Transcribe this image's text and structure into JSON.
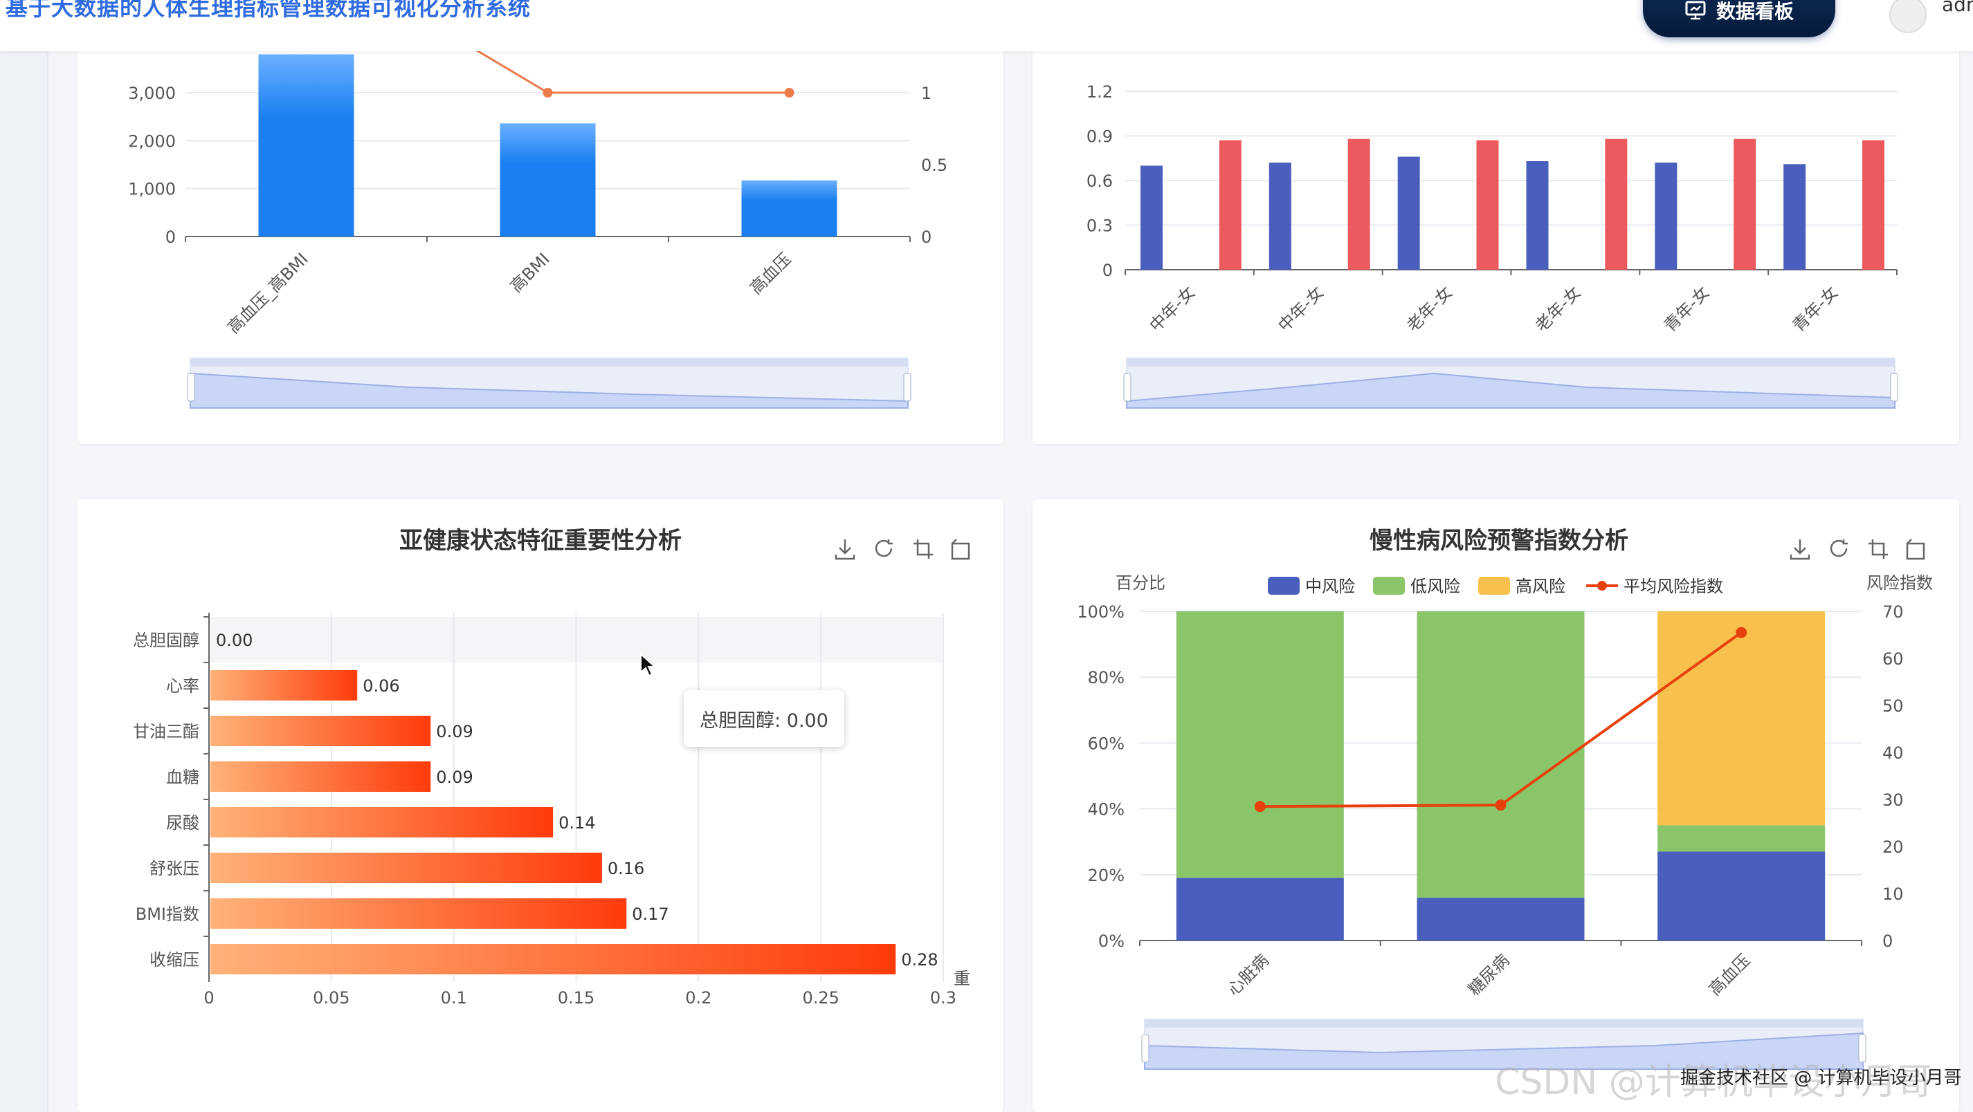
{
  "header": {
    "app_title": "基于大数据的人体生理指标管理数据可视化分析系统",
    "dashboard_button": "数据看板",
    "user": "adm"
  },
  "tooltip": {
    "text": "总胆固醇: 0.00"
  },
  "watermark": {
    "csdn": "CSDN @计算机毕设小月哥",
    "juejin": "掘金技术社区 @ 计算机毕设小月哥"
  },
  "colors": {
    "blue": "#1a7ff0",
    "navy": "#4a5fbd",
    "red": "#ec5a5e",
    "green": "#8ac56a",
    "yellow": "#f8c14e",
    "orange_line": "#e8400c"
  },
  "toolbox_icons": [
    "download-icon",
    "refresh-icon",
    "zoom-icon",
    "restore-icon"
  ],
  "chart_data": [
    {
      "type": "bar",
      "title": "",
      "categories": [
        "高血压_高BMI",
        "高BMI",
        "高血压"
      ],
      "series": [
        {
          "values": [
            3800,
            2360,
            1170
          ],
          "axis": "left"
        },
        {
          "values": [
            2.0,
            1,
            1
          ],
          "axis": "right",
          "kind": "line"
        }
      ],
      "y_ticks": [
        "0",
        "1,000",
        "2,000",
        "3,000"
      ],
      "y2_ticks": [
        "0",
        "0.5",
        "1"
      ],
      "ylim": [
        0,
        3000
      ],
      "y2lim": [
        0,
        1
      ],
      "grid": true
    },
    {
      "type": "bar",
      "title": "",
      "categories": [
        "中年-女",
        "中年-女",
        "老年-女",
        "老年-女",
        "青年-女",
        "青年-女"
      ],
      "series": [
        {
          "values": [
            0.7,
            0.72,
            0.76,
            0.73,
            0.72,
            0.71
          ]
        },
        {
          "values": [
            0.87,
            0.88,
            0.87,
            0.88,
            0.88,
            0.87
          ]
        }
      ],
      "y_ticks": [
        "0",
        "0.3",
        "0.6",
        "0.9",
        "1.2"
      ],
      "ylim": [
        0,
        1.2
      ],
      "grid": true
    },
    {
      "type": "bar",
      "orientation": "horizontal",
      "title": "亚健康状态特征重要性分析",
      "xlabel": "重",
      "categories": [
        "总胆固醇",
        "心率",
        "甘油三酯",
        "血糖",
        "尿酸",
        "舒张压",
        "BMI指数",
        "收缩压"
      ],
      "values": [
        0.0,
        0.06,
        0.09,
        0.09,
        0.14,
        0.16,
        0.17,
        0.28
      ],
      "value_labels": [
        "0.00",
        "0.06",
        "0.09",
        "0.09",
        "0.14",
        "0.16",
        "0.17",
        "0.28"
      ],
      "x_ticks": [
        "0",
        "0.05",
        "0.1",
        "0.15",
        "0.2",
        "0.25",
        "0.3"
      ],
      "xlim": [
        0,
        0.3
      ],
      "grid": true
    },
    {
      "type": "bar",
      "stacked": true,
      "title": "慢性病风险预警指数分析",
      "ylabel": "百分比",
      "y2label": "风险指数",
      "categories": [
        "心脏病",
        "糖尿病",
        "高血压"
      ],
      "series": [
        {
          "name": "中风险",
          "values": [
            19,
            13,
            27
          ]
        },
        {
          "name": "低风险",
          "values": [
            81,
            87,
            8
          ]
        },
        {
          "name": "高风险",
          "values": [
            0,
            0,
            65
          ]
        },
        {
          "name": "平均风险指数",
          "values": [
            28.5,
            28.8,
            65.5
          ],
          "kind": "line",
          "axis": "right"
        }
      ],
      "y_ticks": [
        "0%",
        "20%",
        "40%",
        "60%",
        "80%",
        "100%"
      ],
      "y2_ticks": [
        "0",
        "10",
        "20",
        "30",
        "40",
        "50",
        "60",
        "70"
      ],
      "ylim": [
        0,
        100
      ],
      "y2lim": [
        0,
        70
      ],
      "legend": "top-center",
      "grid": true
    }
  ]
}
